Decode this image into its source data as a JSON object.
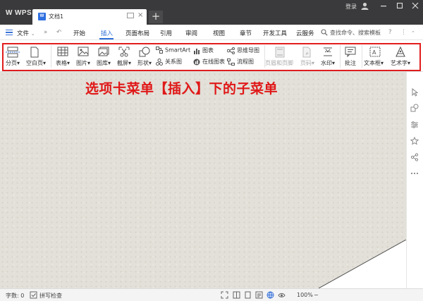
{
  "titlebar": {
    "app_name": "WPS",
    "tab_title": "文档1",
    "doc_badge": "W",
    "new_tab": "+",
    "login": "登录"
  },
  "menubar": {
    "file": "文件",
    "more": "»",
    "items": [
      "开始",
      "插入",
      "页面布局",
      "引用",
      "审阅",
      "视图",
      "章节",
      "开发工具",
      "云服务"
    ],
    "active": "插入",
    "search_placeholder": "查找命令、搜索模板",
    "help": "?",
    "more_options": "⋮"
  },
  "ribbon": {
    "page_break": "分页",
    "blank_page": "空白页",
    "table": "表格",
    "picture": "图片",
    "gallery": "图库",
    "screenshot": "截屏",
    "shape": "形状",
    "smartart": "SmartArt",
    "relation_chart": "关系图",
    "chart": "图表",
    "online_chart": "在线图表",
    "mind_map": "思维导图",
    "flowchart": "流程图",
    "header_footer": "页眉和页脚",
    "page_number": "页码",
    "watermark": "水印",
    "comment": "批注",
    "textbox": "文本框",
    "wordart": "艺术字"
  },
  "caption": "选项卡菜单【插入】下的子菜单",
  "statusbar": {
    "word_count": "字数: 0",
    "spell_check": "拼写检查",
    "zoom": "100%",
    "zoom_minus": "−"
  },
  "colors": {
    "accent": "#2b6dd6",
    "highlight_box": "#e11d1d",
    "caption": "#e01818",
    "titlebar": "#3a3a3c"
  }
}
